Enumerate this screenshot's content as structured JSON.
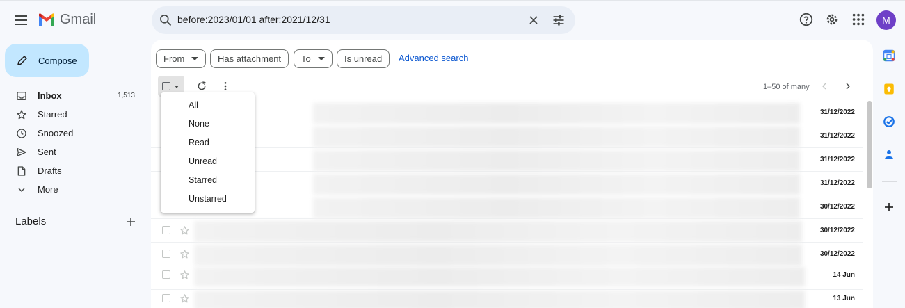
{
  "app": {
    "name": "Gmail",
    "avatar_initial": "M"
  },
  "search": {
    "query": "before:2023/01/01 after:2021/12/31"
  },
  "compose": {
    "label": "Compose"
  },
  "nav": {
    "items": [
      {
        "label": "Inbox",
        "count": "1,513",
        "icon": "inbox-icon"
      },
      {
        "label": "Starred",
        "count": "",
        "icon": "star-icon"
      },
      {
        "label": "Snoozed",
        "count": "",
        "icon": "clock-icon"
      },
      {
        "label": "Sent",
        "count": "",
        "icon": "send-icon"
      },
      {
        "label": "Drafts",
        "count": "",
        "icon": "draft-icon"
      },
      {
        "label": "More",
        "count": "",
        "icon": "chevron-down-icon"
      }
    ],
    "labels_title": "Labels"
  },
  "filters": {
    "from": "From",
    "has_attachment": "Has attachment",
    "to": "To",
    "is_unread": "Is unread",
    "advanced": "Advanced search"
  },
  "toolbar": {
    "pagination": "1–50 of many"
  },
  "select_menu": {
    "options": [
      "All",
      "None",
      "Read",
      "Unread",
      "Starred",
      "Unstarred"
    ]
  },
  "emails": [
    {
      "date": "31/12/2022"
    },
    {
      "date": "31/12/2022"
    },
    {
      "date": "31/12/2022"
    },
    {
      "date": "31/12/2022"
    },
    {
      "date": "30/12/2022"
    },
    {
      "date": "30/12/2022"
    },
    {
      "date": "30/12/2022"
    },
    {
      "date": "14 Jun"
    },
    {
      "date": "13 Jun"
    }
  ],
  "colors": {
    "accent": "#0b57d0",
    "compose_bg": "#c2e7ff",
    "avatar_bg": "#6e3fc7",
    "background": "#f6f8fc"
  }
}
